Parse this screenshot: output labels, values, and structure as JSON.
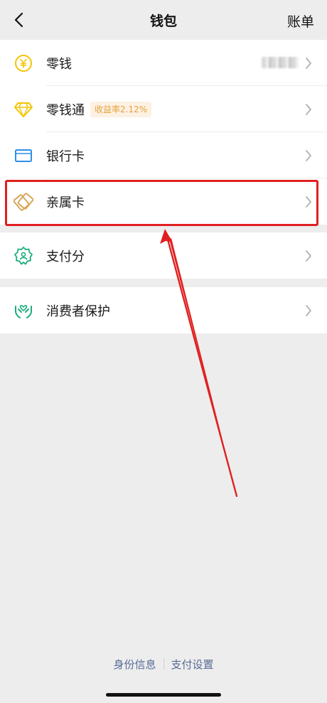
{
  "nav": {
    "title": "钱包",
    "right": "账单"
  },
  "group1": {
    "items": [
      {
        "label": "零钱"
      },
      {
        "label": "零钱通",
        "badge": "收益率2.12%"
      },
      {
        "label": "银行卡"
      },
      {
        "label": "亲属卡"
      }
    ]
  },
  "group2": {
    "items": [
      {
        "label": "支付分"
      }
    ]
  },
  "group3": {
    "items": [
      {
        "label": "消费者保护"
      }
    ]
  },
  "footer": {
    "left": "身份信息",
    "right": "支付设置"
  },
  "colors": {
    "accent": "#07c160",
    "highlight": "#e02020",
    "link": "#576b95"
  }
}
